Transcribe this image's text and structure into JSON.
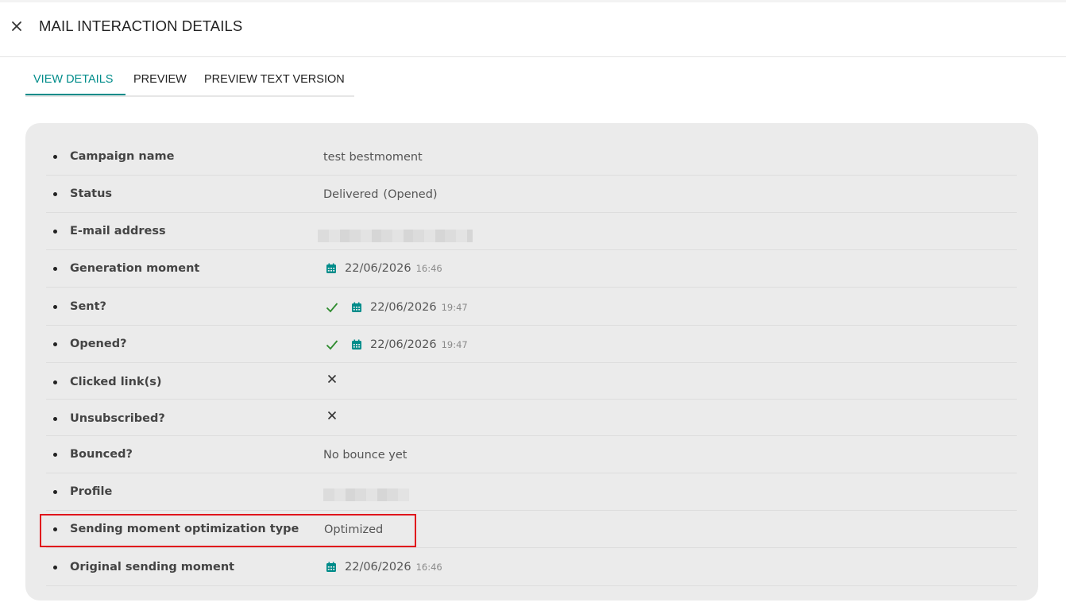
{
  "header": {
    "title": "MAIL INTERACTION DETAILS"
  },
  "tabs": [
    {
      "label": "VIEW DETAILS",
      "active": true
    },
    {
      "label": "PREVIEW",
      "active": false
    },
    {
      "label": "PREVIEW TEXT VERSION",
      "active": false
    }
  ],
  "details": {
    "campaign_name": {
      "label": "Campaign name",
      "value": "test bestmoment"
    },
    "status": {
      "label": "Status",
      "value": "Delivered",
      "sub": "(Opened)"
    },
    "email": {
      "label": "E-mail address"
    },
    "generation": {
      "label": "Generation moment",
      "date": "22/06/2026",
      "time": "16:46"
    },
    "sent": {
      "label": "Sent?",
      "date": "22/06/2026",
      "time": "19:47"
    },
    "opened": {
      "label": "Opened?",
      "date": "22/06/2026",
      "time": "19:47"
    },
    "clicked": {
      "label": "Clicked link(s)"
    },
    "unsubscribed": {
      "label": "Unsubscribed?"
    },
    "bounced": {
      "label": "Bounced?",
      "value": "No bounce yet"
    },
    "profile": {
      "label": "Profile"
    },
    "smo_type": {
      "label": "Sending moment optimization type",
      "value": "Optimized"
    },
    "original": {
      "label": "Original sending moment",
      "date": "22/06/2026",
      "time": "16:46"
    }
  },
  "colors": {
    "accent": "#008c8a",
    "check": "#2e8b2e",
    "highlight": "#e0141c",
    "panel": "#ebebeb"
  }
}
